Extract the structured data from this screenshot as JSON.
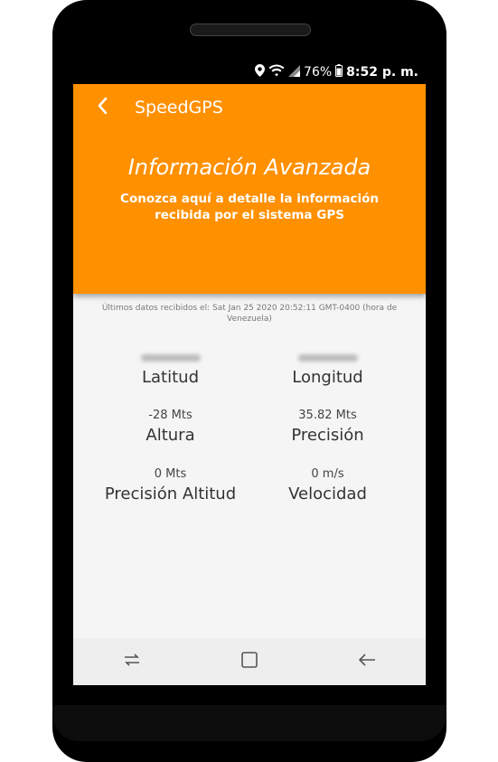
{
  "status_bar": {
    "battery": "76%",
    "time": "8:52 p. m."
  },
  "toolbar": {
    "title": "SpeedGPS"
  },
  "header": {
    "title": "Información Avanzada",
    "subtitle": "Conozca aquí a detalle la información recibida por el sistema GPS"
  },
  "last_data": "Últimos datos recibidos el: Sat Jan 25 2020 20:52:11 GMT-0400 (hora de Venezuela)",
  "fields": {
    "latitud": {
      "label": "Latitud",
      "value": ""
    },
    "longitud": {
      "label": "Longitud",
      "value": ""
    },
    "altura": {
      "label": "Altura",
      "value": "-28 Mts"
    },
    "precision": {
      "label": "Precisión",
      "value": "35.82 Mts"
    },
    "precision_altitud": {
      "label": "Precisión Altitud",
      "value": "0 Mts"
    },
    "velocidad": {
      "label": "Velocidad",
      "value": "0 m/s"
    }
  },
  "colors": {
    "accent": "#ff9000",
    "background": "#f5f5f5"
  }
}
